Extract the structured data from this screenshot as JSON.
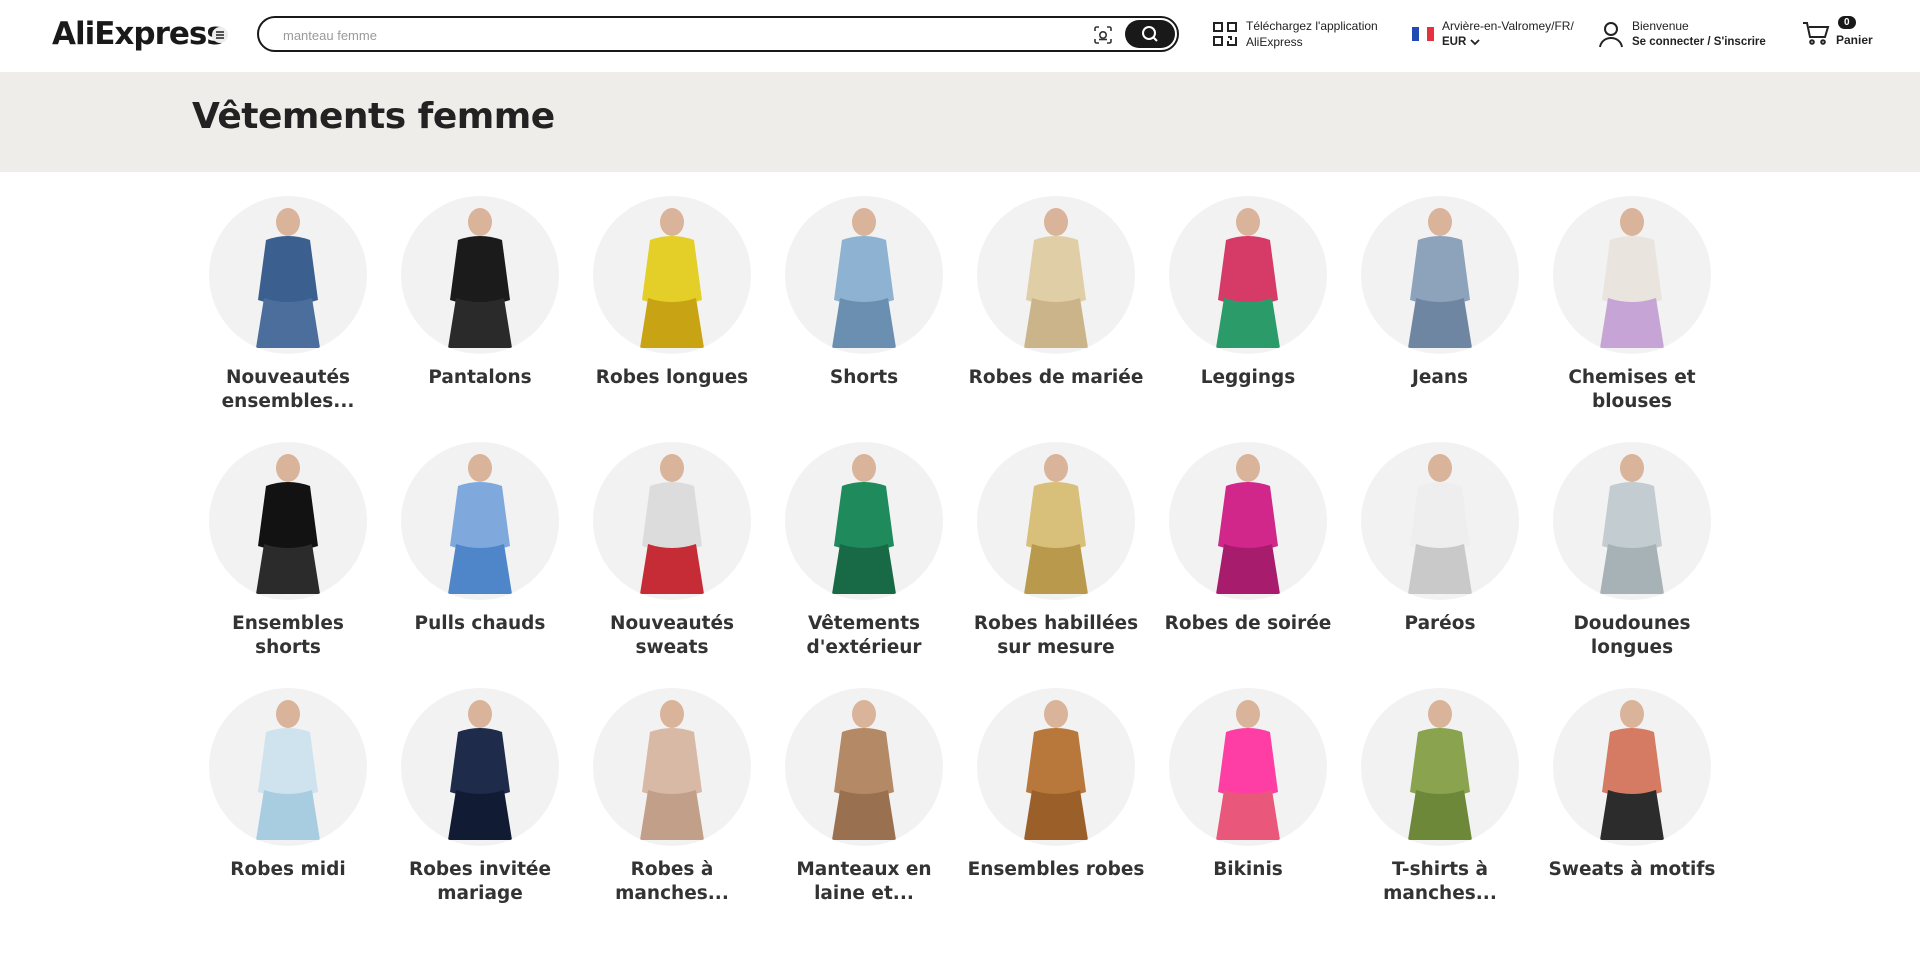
{
  "header": {
    "logo_text": "AliExpress",
    "search": {
      "placeholder": "manteau femme"
    },
    "app": {
      "line1": "Téléchargez l'application",
      "line2": "AliExpress"
    },
    "locale": {
      "line1": "Arvière-en-Valromey/FR/",
      "currency": "EUR"
    },
    "account": {
      "line1": "Bienvenue",
      "line2": "Se connecter / S'inscrire"
    },
    "cart": {
      "count": "0",
      "label": "Panier"
    }
  },
  "banner": {
    "title": "Vêtements femme"
  },
  "categories": [
    {
      "label": "Nouveautés ensembles...",
      "icon": "denim-set-image"
    },
    {
      "label": "Pantalons",
      "icon": "black-flare-pants-image"
    },
    {
      "label": "Robes longues",
      "icon": "yellow-long-dress-image"
    },
    {
      "label": "Shorts",
      "icon": "denim-shorts-image"
    },
    {
      "label": "Robes de mariée",
      "icon": "wedding-dress-image"
    },
    {
      "label": "Leggings",
      "icon": "colorful-leggings-image"
    },
    {
      "label": "Jeans",
      "icon": "flare-jeans-image"
    },
    {
      "label": "Chemises et blouses",
      "icon": "lace-blouse-image"
    },
    {
      "label": "Ensembles shorts",
      "icon": "black-shorts-set-image"
    },
    {
      "label": "Pulls chauds",
      "icon": "blue-sweater-image"
    },
    {
      "label": "Nouveautés sweats",
      "icon": "1990-sweatshirt-image"
    },
    {
      "label": "Vêtements d'extérieur",
      "icon": "green-blazer-image"
    },
    {
      "label": "Robes habillées sur mesure",
      "icon": "gold-gown-image"
    },
    {
      "label": "Robes de soirée",
      "icon": "pink-bodycon-dress-image"
    },
    {
      "label": "Paréos",
      "icon": "white-maxi-dress-image"
    },
    {
      "label": "Doudounes longues",
      "icon": "long-puffer-coat-image"
    },
    {
      "label": "Robes midi",
      "icon": "light-blue-midi-dress-image"
    },
    {
      "label": "Robes invitée mariage",
      "icon": "navy-gown-image"
    },
    {
      "label": "Robes à manches...",
      "icon": "beige-sleeved-dress-image"
    },
    {
      "label": "Manteaux en laine et...",
      "icon": "camel-wool-coat-image"
    },
    {
      "label": "Ensembles robes",
      "icon": "brown-dress-set-image"
    },
    {
      "label": "Bikinis",
      "icon": "pink-bikini-image"
    },
    {
      "label": "T-shirts à manches...",
      "icon": "green-long-sleeve-tee-image"
    },
    {
      "label": "Sweats à motifs",
      "icon": "printed-sweatshirt-image"
    }
  ],
  "colors": {
    "flag_blue": "#1f4bb3",
    "flag_white": "#ffffff",
    "flag_red": "#e63140",
    "banner_bg": "#efedea",
    "circle_bg": "#f2f2f2"
  }
}
